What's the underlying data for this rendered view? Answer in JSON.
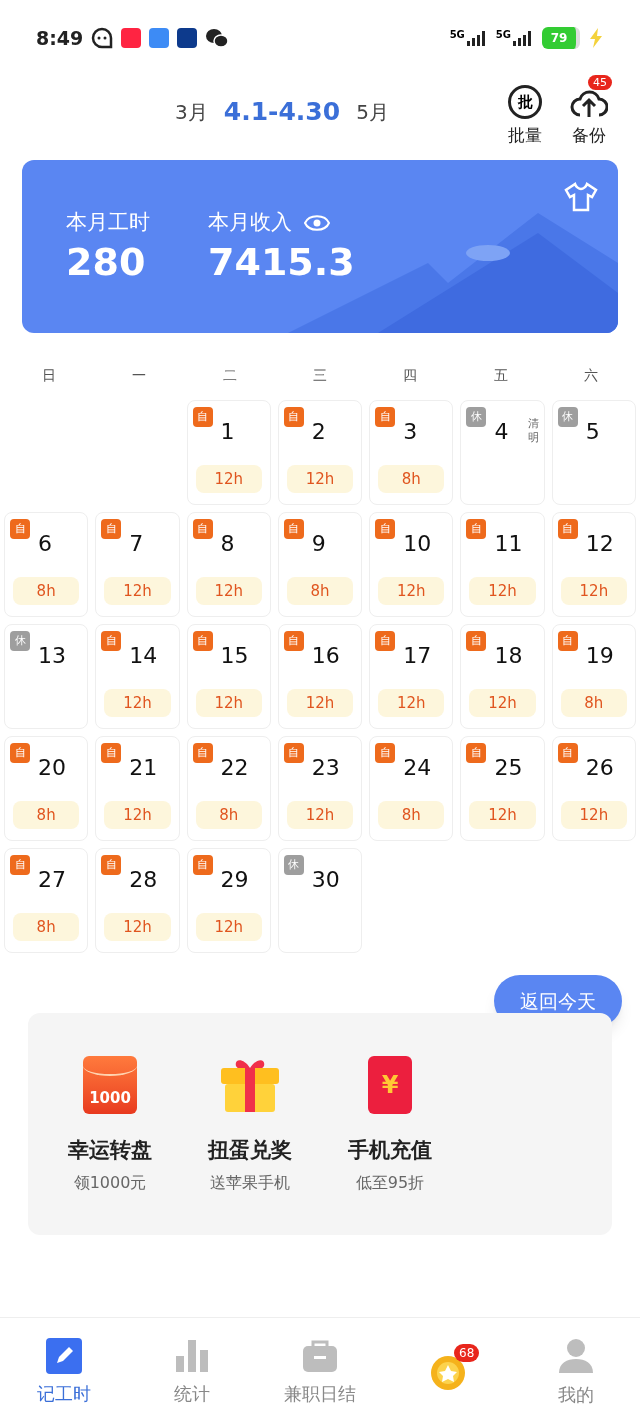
{
  "status_bar": {
    "time": "8:49",
    "network_1": "5G",
    "network_2": "5G",
    "battery": "79"
  },
  "header": {
    "prev_month": "3月",
    "range": "4.1-4.30",
    "next_month": "5月",
    "actions": [
      {
        "label": "批量",
        "icon_text": "批"
      },
      {
        "label": "备份",
        "badge": "45"
      }
    ]
  },
  "summary": {
    "hours_label": "本月工时",
    "hours": "280",
    "income_label": "本月收入",
    "income": "7415.3"
  },
  "weekdays": [
    "日",
    "一",
    "二",
    "三",
    "四",
    "五",
    "六"
  ],
  "calendar": {
    "days": [
      {
        "day": "1",
        "kind": "work",
        "tag": "自",
        "hours": "12h"
      },
      {
        "day": "2",
        "kind": "work",
        "tag": "自",
        "hours": "12h"
      },
      {
        "day": "3",
        "kind": "work",
        "tag": "自",
        "hours": "8h"
      },
      {
        "day": "4",
        "kind": "rest",
        "tag": "休",
        "note": "清明"
      },
      {
        "day": "5",
        "kind": "rest",
        "tag": "休"
      },
      {
        "day": "6",
        "kind": "work",
        "tag": "自",
        "hours": "8h"
      },
      {
        "day": "7",
        "kind": "work",
        "tag": "自",
        "hours": "12h"
      },
      {
        "day": "8",
        "kind": "work",
        "tag": "自",
        "hours": "12h"
      },
      {
        "day": "9",
        "kind": "work",
        "tag": "自",
        "hours": "8h"
      },
      {
        "day": "10",
        "kind": "work",
        "tag": "自",
        "hours": "12h"
      },
      {
        "day": "11",
        "kind": "work",
        "tag": "自",
        "hours": "12h"
      },
      {
        "day": "12",
        "kind": "work",
        "tag": "自",
        "hours": "12h"
      },
      {
        "day": "13",
        "kind": "rest",
        "tag": "休"
      },
      {
        "day": "14",
        "kind": "work",
        "tag": "自",
        "hours": "12h"
      },
      {
        "day": "15",
        "kind": "work",
        "tag": "自",
        "hours": "12h"
      },
      {
        "day": "16",
        "kind": "work",
        "tag": "自",
        "hours": "12h"
      },
      {
        "day": "17",
        "kind": "work",
        "tag": "自",
        "hours": "12h"
      },
      {
        "day": "18",
        "kind": "work",
        "tag": "自",
        "hours": "12h"
      },
      {
        "day": "19",
        "kind": "work",
        "tag": "自",
        "hours": "8h"
      },
      {
        "day": "20",
        "kind": "work",
        "tag": "自",
        "hours": "8h"
      },
      {
        "day": "21",
        "kind": "work",
        "tag": "自",
        "hours": "12h"
      },
      {
        "day": "22",
        "kind": "work",
        "tag": "自",
        "hours": "8h"
      },
      {
        "day": "23",
        "kind": "work",
        "tag": "自",
        "hours": "12h"
      },
      {
        "day": "24",
        "kind": "work",
        "tag": "自",
        "hours": "8h"
      },
      {
        "day": "25",
        "kind": "work",
        "tag": "自",
        "hours": "12h"
      },
      {
        "day": "26",
        "kind": "work",
        "tag": "自",
        "hours": "12h"
      },
      {
        "day": "27",
        "kind": "work",
        "tag": "自",
        "hours": "8h"
      },
      {
        "day": "28",
        "kind": "work",
        "tag": "自",
        "hours": "12h"
      },
      {
        "day": "29",
        "kind": "work",
        "tag": "自",
        "hours": "12h"
      },
      {
        "day": "30",
        "kind": "rest",
        "tag": "休"
      }
    ]
  },
  "today_button": "返回今天",
  "promos": [
    {
      "kind": "envelope",
      "icon_text": "1000",
      "title": "幸运转盘",
      "subtitle": "领1000元"
    },
    {
      "kind": "gift",
      "title": "扭蛋兑奖",
      "subtitle": "送苹果手机"
    },
    {
      "kind": "redpacket",
      "icon_text": "¥",
      "title": "手机充值",
      "subtitle": "低至95折"
    }
  ],
  "tab_bar": [
    {
      "kind": "edit",
      "label": "记工时",
      "selected": true
    },
    {
      "kind": "stats",
      "label": "统计",
      "selected": false
    },
    {
      "kind": "bag",
      "label": "兼职日结",
      "selected": false
    },
    {
      "kind": "coin",
      "badge": "68",
      "selected": false
    },
    {
      "kind": "user",
      "label": "我的",
      "selected": false
    }
  ]
}
